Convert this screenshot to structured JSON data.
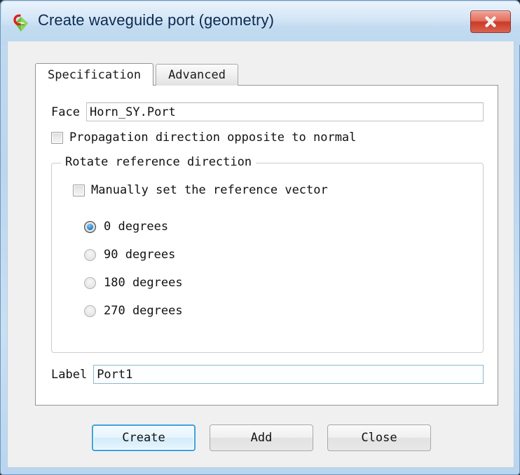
{
  "window": {
    "title": "Create waveguide port (geometry)",
    "icon": "cst-studio-icon",
    "close_label": "close-icon",
    "accent_blue": "#3da2e0",
    "titlebar_text_color": "#0c2a52",
    "close_button_color": "#c93b28"
  },
  "tabs": [
    {
      "label": "Specification",
      "active": true
    },
    {
      "label": "Advanced",
      "active": false
    }
  ],
  "form": {
    "face": {
      "label": "Face",
      "value": "Horn_SY.Port",
      "placeholder": ""
    },
    "propagation_checkbox": {
      "label": "Propagation direction opposite to normal",
      "checked": false
    },
    "group": {
      "title": "Rotate reference direction",
      "manual_checkbox": {
        "label": "Manually set the reference vector",
        "checked": false
      },
      "rotation_options": [
        {
          "label": "0 degrees",
          "selected": true
        },
        {
          "label": "90 degrees",
          "selected": false
        },
        {
          "label": "180 degrees",
          "selected": false
        },
        {
          "label": "270 degrees",
          "selected": false
        }
      ]
    },
    "port_label": {
      "label": "Label",
      "value": "Port1",
      "placeholder": ""
    }
  },
  "buttons": [
    {
      "label": "Create",
      "default": true
    },
    {
      "label": "Add",
      "default": false
    },
    {
      "label": "Close",
      "default": false
    }
  ]
}
